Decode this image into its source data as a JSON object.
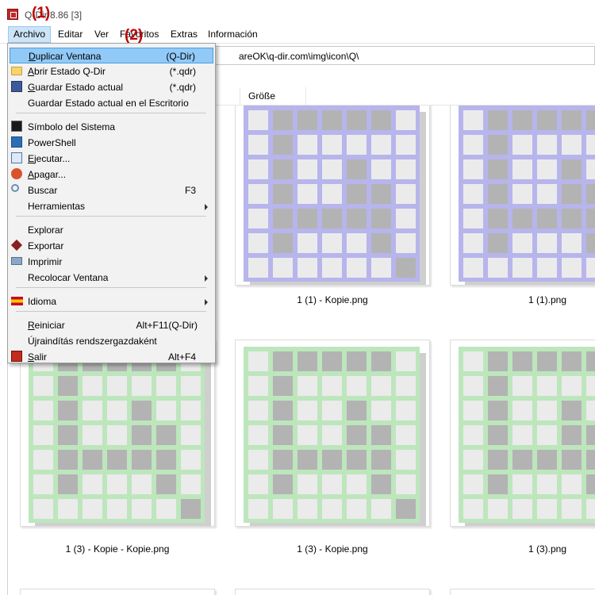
{
  "window": {
    "title_visible": "Q-Dir 8.86 [3]"
  },
  "annotations": [
    "(1)",
    "(2)"
  ],
  "menubar": [
    "Archivo",
    "Editar",
    "Ver",
    "Favoritos",
    "Extras",
    "Información"
  ],
  "address": {
    "path_visible": "areOK\\q-dir.com\\img\\icon\\Q\\"
  },
  "column_header": {
    "size": "Größe"
  },
  "dropdown": {
    "items": [
      {
        "label": "Duplicar Ventana",
        "accel": "(Q-Dir)",
        "highlighted": true,
        "icon": ""
      },
      {
        "label": "Abrir Estado Q-Dir",
        "accel": "(*.qdr)",
        "icon": "folder-icon"
      },
      {
        "label": "Guardar Estado actual",
        "accel": "(*.qdr)",
        "icon": "floppy-disk-icon"
      },
      {
        "label": "Guardar Estado actual en el Escritorio",
        "accel": "",
        "icon": ""
      },
      {
        "label": "Símbolo del Sistema",
        "accel": "",
        "icon": "command-prompt-icon"
      },
      {
        "label": "PowerShell",
        "accel": "",
        "icon": "powershell-icon"
      },
      {
        "label": "Ejecutar...",
        "accel": "",
        "icon": "run-icon"
      },
      {
        "label": "Apagar...",
        "accel": "",
        "icon": "power-icon"
      },
      {
        "label": "Buscar",
        "accel": "F3",
        "icon": "magnifier-icon"
      },
      {
        "label": "Herramientas",
        "accel": "",
        "submenu": true,
        "icon": ""
      },
      {
        "label": "Explorar",
        "accel": "",
        "icon": ""
      },
      {
        "label": "Exportar",
        "accel": "",
        "icon": "export-icon"
      },
      {
        "label": "Imprimir",
        "accel": "",
        "icon": "printer-icon"
      },
      {
        "label": "Recolocar Ventana",
        "accel": "",
        "submenu": true,
        "icon": ""
      },
      {
        "label": "Idioma",
        "accel": "",
        "submenu": true,
        "icon": "spain-flag-icon"
      },
      {
        "label": "Reiniciar",
        "accel": "Alt+F11(Q-Dir)",
        "icon": ""
      },
      {
        "label": "Újraindítás rendszergazdaként",
        "accel": "",
        "icon": ""
      },
      {
        "label": "Salir",
        "accel": "Alt+F4",
        "icon": "exit-icon"
      }
    ]
  },
  "files": [
    {
      "name": "1 (1) - Kopie.png",
      "color": "#b7b5ec"
    },
    {
      "name": "1 (1).png",
      "color": "#b7b5ec"
    },
    {
      "name": "1 (3) - Kopie - Kopie.png",
      "color": "#bde6bd"
    },
    {
      "name": "1 (3) - Kopie.png",
      "color": "#bde6bd"
    },
    {
      "name": "1 (3).png",
      "color": "#bde6bd"
    }
  ],
  "colors": {
    "cell_light": "#ebebeb",
    "cell_dark": "#b3b3b3",
    "menu_highlight": "#91c9f7",
    "annotation": "#c00000"
  }
}
